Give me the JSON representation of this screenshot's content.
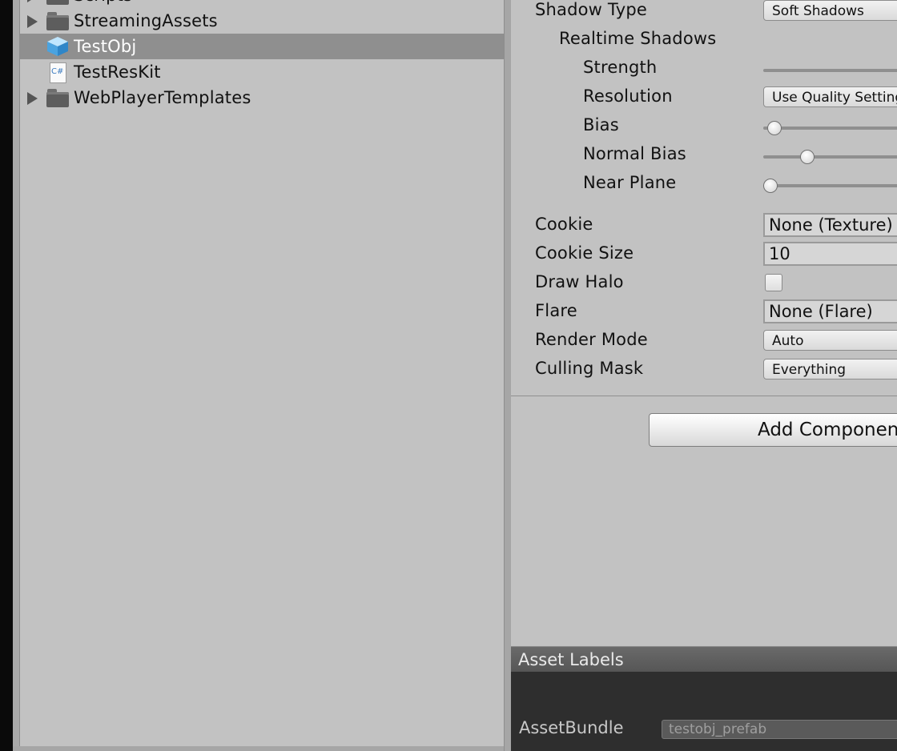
{
  "project": {
    "items": [
      {
        "label": "Scripts"
      },
      {
        "label": "StreamingAssets"
      },
      {
        "label": "TestObj"
      },
      {
        "label": "TestResKit"
      },
      {
        "label": "WebPlayerTemplates"
      }
    ],
    "cs_icon_text": "C#"
  },
  "inspector": {
    "shadow_type": {
      "label": "Shadow Type",
      "value": "Soft Shadows"
    },
    "realtime_shadows": {
      "label": "Realtime Shadows"
    },
    "strength": {
      "label": "Strength"
    },
    "resolution": {
      "label": "Resolution",
      "value": "Use Quality Settings"
    },
    "bias": {
      "label": "Bias"
    },
    "normal_bias": {
      "label": "Normal Bias"
    },
    "near_plane": {
      "label": "Near Plane"
    },
    "cookie": {
      "label": "Cookie",
      "value": "None (Texture)"
    },
    "cookie_size": {
      "label": "Cookie Size",
      "value": "10"
    },
    "draw_halo": {
      "label": "Draw Halo",
      "checked": false
    },
    "flare": {
      "label": "Flare",
      "value": "None (Flare)"
    },
    "render_mode": {
      "label": "Render Mode",
      "value": "Auto"
    },
    "culling_mask": {
      "label": "Culling Mask",
      "value": "Everything"
    },
    "add_component": "Add Component"
  },
  "asset_labels": {
    "header": "Asset Labels",
    "assetbundle_label": "AssetBundle",
    "assetbundle_value": "testobj_prefab"
  }
}
